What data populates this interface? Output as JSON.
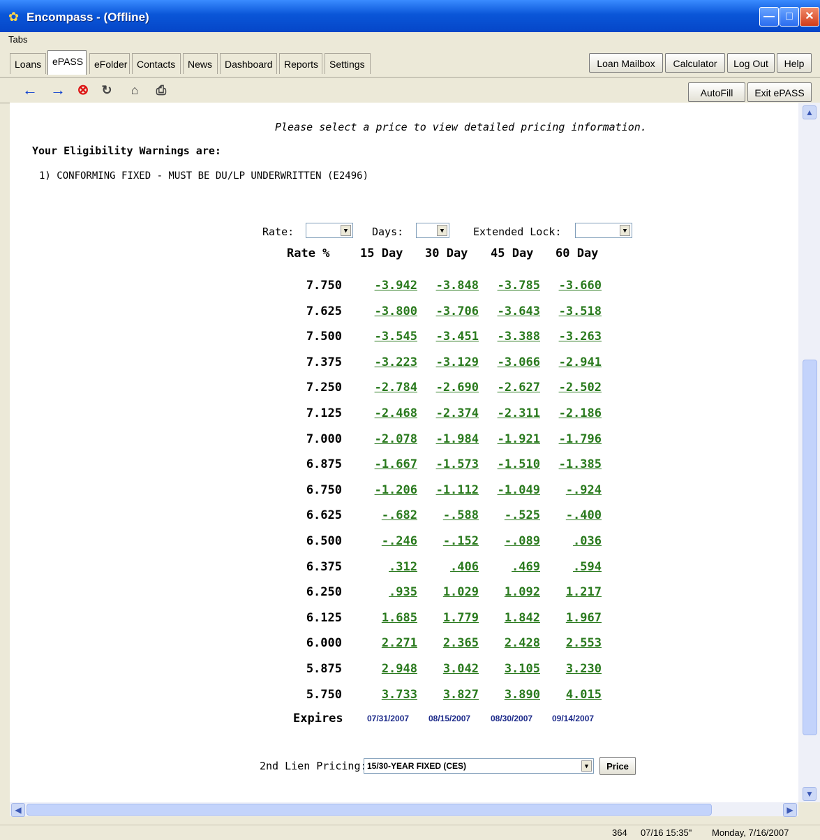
{
  "window": {
    "title": "Encompass - (Offline)"
  },
  "menu": {
    "label": "Tabs"
  },
  "tabs": [
    {
      "label": "Loans"
    },
    {
      "label": "ePASS"
    },
    {
      "label": "eFolder"
    },
    {
      "label": "Contacts"
    },
    {
      "label": "News"
    },
    {
      "label": "Dashboard"
    },
    {
      "label": "Reports"
    },
    {
      "label": "Settings"
    }
  ],
  "top_buttons": {
    "mailbox": "Loan Mailbox",
    "calculator": "Calculator",
    "logout": "Log Out",
    "help": "Help"
  },
  "toolbar": {
    "autofill": "AutoFill",
    "exit": "Exit ePASS"
  },
  "content": {
    "instruction": "Please select a price to view detailed pricing information.",
    "warnings_title": "Your Eligibility Warnings are:",
    "warning_1": "1) CONFORMING FIXED - MUST BE DU/LP UNDERWRITTEN (E2496)",
    "filters": {
      "rate_label": "Rate:",
      "days_label": "Days:",
      "extended_label": "Extended Lock:"
    },
    "headers": {
      "rate": "Rate %",
      "d15": "15 Day",
      "d30": "30 Day",
      "d45": "45 Day",
      "d60": "60 Day"
    },
    "rows": [
      {
        "rate": "7.750",
        "d15": "-3.942",
        "d30": "-3.848",
        "d45": "-3.785",
        "d60": "-3.660"
      },
      {
        "rate": "7.625",
        "d15": "-3.800",
        "d30": "-3.706",
        "d45": "-3.643",
        "d60": "-3.518"
      },
      {
        "rate": "7.500",
        "d15": "-3.545",
        "d30": "-3.451",
        "d45": "-3.388",
        "d60": "-3.263"
      },
      {
        "rate": "7.375",
        "d15": "-3.223",
        "d30": "-3.129",
        "d45": "-3.066",
        "d60": "-2.941"
      },
      {
        "rate": "7.250",
        "d15": "-2.784",
        "d30": "-2.690",
        "d45": "-2.627",
        "d60": "-2.502"
      },
      {
        "rate": "7.125",
        "d15": "-2.468",
        "d30": "-2.374",
        "d45": "-2.311",
        "d60": "-2.186"
      },
      {
        "rate": "7.000",
        "d15": "-2.078",
        "d30": "-1.984",
        "d45": "-1.921",
        "d60": "-1.796"
      },
      {
        "rate": "6.875",
        "d15": "-1.667",
        "d30": "-1.573",
        "d45": "-1.510",
        "d60": "-1.385"
      },
      {
        "rate": "6.750",
        "d15": "-1.206",
        "d30": "-1.112",
        "d45": "-1.049",
        "d60": "-.924"
      },
      {
        "rate": "6.625",
        "d15": "-.682",
        "d30": "-.588",
        "d45": "-.525",
        "d60": "-.400"
      },
      {
        "rate": "6.500",
        "d15": "-.246",
        "d30": "-.152",
        "d45": "-.089",
        "d60": ".036"
      },
      {
        "rate": "6.375",
        "d15": ".312",
        "d30": ".406",
        "d45": ".469",
        "d60": ".594"
      },
      {
        "rate": "6.250",
        "d15": ".935",
        "d30": "1.029",
        "d45": "1.092",
        "d60": "1.217"
      },
      {
        "rate": "6.125",
        "d15": "1.685",
        "d30": "1.779",
        "d45": "1.842",
        "d60": "1.967"
      },
      {
        "rate": "6.000",
        "d15": "2.271",
        "d30": "2.365",
        "d45": "2.428",
        "d60": "2.553"
      },
      {
        "rate": "5.875",
        "d15": "2.948",
        "d30": "3.042",
        "d45": "3.105",
        "d60": "3.230"
      },
      {
        "rate": "5.750",
        "d15": "3.733",
        "d30": "3.827",
        "d45": "3.890",
        "d60": "4.015"
      }
    ],
    "expires": {
      "label": "Expires",
      "d15": "07/31/2007",
      "d30": "08/15/2007",
      "d45": "08/30/2007",
      "d60": "09/14/2007"
    },
    "second_lien": {
      "label": "2nd Lien Pricing:",
      "value": "15/30-YEAR FIXED (CES)",
      "button": "Price"
    }
  },
  "status": {
    "count": "364",
    "timestamp": "07/16 15:35\"",
    "date": "Monday, 7/16/2007"
  },
  "colors": {
    "price_link": "#2a7a1e",
    "expires_text": "#1d2b8a",
    "titlebar": "#0a56d8"
  },
  "icons": [
    "app-logo-icon",
    "back-arrow-icon",
    "forward-arrow-icon",
    "stop-icon",
    "refresh-icon",
    "home-icon",
    "print-icon"
  ]
}
